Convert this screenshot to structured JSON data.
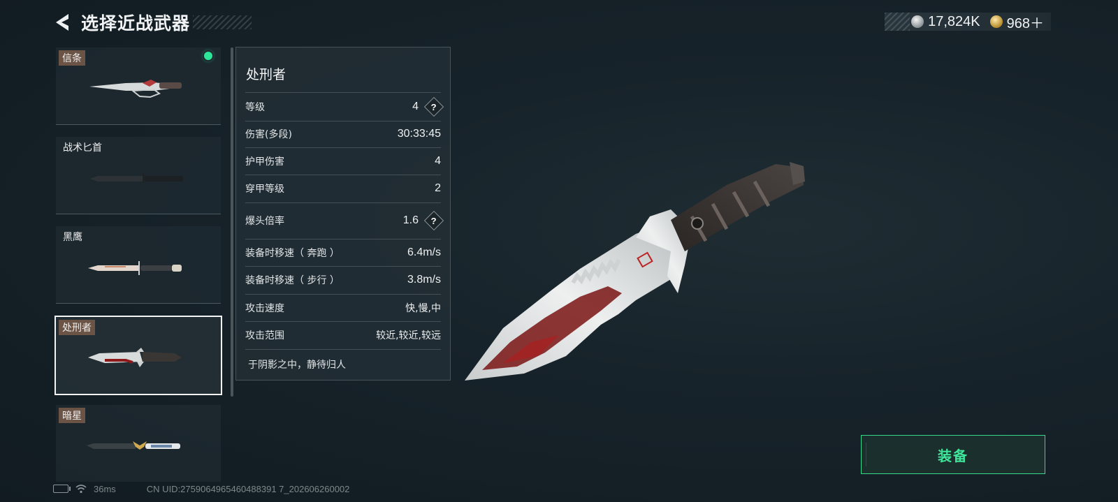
{
  "header": {
    "title": "选择近战武器"
  },
  "currency": {
    "silver": "17,824K",
    "gold": "968＋"
  },
  "weapons": [
    {
      "name": "信条",
      "tagged": true,
      "equipped": true
    },
    {
      "name": "战术匕首",
      "tagged": false,
      "equipped": false
    },
    {
      "name": "黑鹰",
      "tagged": false,
      "equipped": false
    },
    {
      "name": "处刑者",
      "tagged": true,
      "equipped": false,
      "selected": true
    },
    {
      "name": "暗星",
      "tagged": true,
      "equipped": false
    }
  ],
  "detail": {
    "name": "处刑者",
    "stats": [
      {
        "label": "等级",
        "value": "4",
        "help": true
      },
      {
        "label": "伤害(多段)",
        "value": "30:33:45"
      },
      {
        "label": "护甲伤害",
        "value": "4"
      },
      {
        "label": "穿甲等级",
        "value": "2"
      },
      {
        "label": "爆头倍率",
        "value": "1.6",
        "help": true
      },
      {
        "label": "装备时移速（ 奔跑 ）",
        "value": "6.4m/s"
      },
      {
        "label": "装备时移速（ 步行 ）",
        "value": "3.8m/s"
      },
      {
        "label": "攻击速度",
        "value": "快,慢,中"
      },
      {
        "label": "攻击范围",
        "value": "较近,较近,较远"
      }
    ],
    "description": "于阴影之中，静待归人"
  },
  "equip_button": {
    "label": "装备"
  },
  "status": {
    "ping": "36ms",
    "uid": "CN UID:2759064965460488391 7_202606260002"
  },
  "colors": {
    "accent": "#3fe59a",
    "equipped_dot": "#2ee69a",
    "tag_bg": "#6b5446"
  }
}
